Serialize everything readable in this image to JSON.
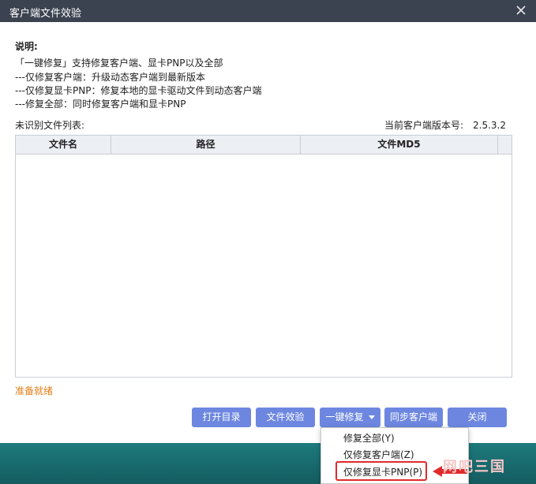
{
  "dialog": {
    "title": "客户端文件效验"
  },
  "description": {
    "heading": "说明:",
    "lines": [
      "「一键修复」支持修复客户端、显卡PNP以及全部",
      "---仅修复客户端：升级动态客户端到最新版本",
      "---仅修复显卡PNP：修复本地的显卡驱动文件到动态客户端",
      "---修复全部：同时修复客户端和显卡PNP"
    ]
  },
  "list": {
    "label": "未识别文件列表:"
  },
  "version": {
    "label": "当前客户端版本号:",
    "value": "2.5.3.2"
  },
  "table": {
    "columns": [
      "文件名",
      "路径",
      "文件MD5"
    ],
    "rows": []
  },
  "status": {
    "text": "准备就绪",
    "color": "#e27c13"
  },
  "buttons": {
    "open_dir": "打开目录",
    "verify": "文件效验",
    "one_click_repair": "一键修复",
    "sync_client": "同步客户端",
    "close": "关闭"
  },
  "menu": {
    "items": [
      "修复全部(Y)",
      "仅修复客户端(Z)",
      "仅修复显卡PNP(P)"
    ],
    "highlighted_index": 2
  },
  "watermark": {
    "text": "网吧三国"
  },
  "colors": {
    "accent": "#6d87e0",
    "titlebar": "#3b4350",
    "highlight": "#e02b2b"
  }
}
